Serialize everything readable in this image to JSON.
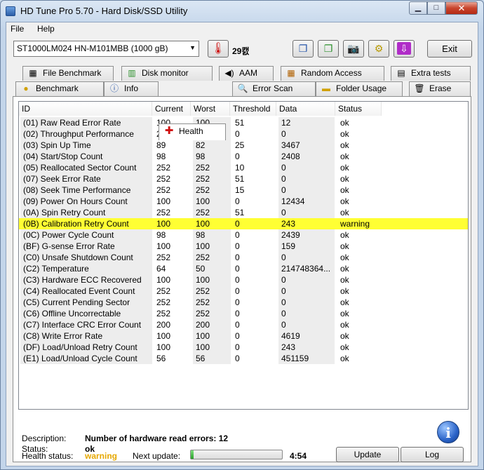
{
  "window": {
    "title": "HD Tune Pro 5.70 - Hard Disk/SSD Utility"
  },
  "menu": {
    "file": "File",
    "help": "Help"
  },
  "toolbar": {
    "drive": "ST1000LM024 HN-M101MBB (1000 gB)",
    "temperature": "29캜",
    "exit_label": "Exit"
  },
  "tabs_top": [
    {
      "label": "File Benchmark",
      "icon": "file-benchmark-icon"
    },
    {
      "label": "Disk monitor",
      "icon": "disk-monitor-icon"
    },
    {
      "label": "AAM",
      "icon": "speaker-icon"
    },
    {
      "label": "Random Access",
      "icon": "random-access-icon"
    },
    {
      "label": "Extra tests",
      "icon": "extra-tests-icon"
    }
  ],
  "tabs_bottom": [
    {
      "label": "Benchmark",
      "icon": "benchmark-icon"
    },
    {
      "label": "Info",
      "icon": "info-icon"
    },
    {
      "label": "Health",
      "icon": "health-cross-icon"
    },
    {
      "label": "Error Scan",
      "icon": "magnifier-icon"
    },
    {
      "label": "Folder Usage",
      "icon": "folder-icon"
    },
    {
      "label": "Erase",
      "icon": "trash-icon"
    }
  ],
  "table": {
    "headers": [
      "ID",
      "Current",
      "Worst",
      "Threshold",
      "Data",
      "Status"
    ],
    "rows": [
      [
        "(01) Raw Read Error Rate",
        "100",
        "100",
        "51",
        "12",
        "ok"
      ],
      [
        "(02) Throughput Performance",
        "252",
        "252",
        "0",
        "0",
        "ok"
      ],
      [
        "(03) Spin Up Time",
        "89",
        "82",
        "25",
        "3467",
        "ok"
      ],
      [
        "(04) Start/Stop Count",
        "98",
        "98",
        "0",
        "2408",
        "ok"
      ],
      [
        "(05) Reallocated Sector Count",
        "252",
        "252",
        "10",
        "0",
        "ok"
      ],
      [
        "(07) Seek Error Rate",
        "252",
        "252",
        "51",
        "0",
        "ok"
      ],
      [
        "(08) Seek Time Performance",
        "252",
        "252",
        "15",
        "0",
        "ok"
      ],
      [
        "(09) Power On Hours Count",
        "100",
        "100",
        "0",
        "12434",
        "ok"
      ],
      [
        "(0A) Spin Retry Count",
        "252",
        "252",
        "51",
        "0",
        "ok"
      ],
      [
        "(0B) Calibration Retry Count",
        "100",
        "100",
        "0",
        "243",
        "warning"
      ],
      [
        "(0C) Power Cycle Count",
        "98",
        "98",
        "0",
        "2439",
        "ok"
      ],
      [
        "(BF) G-sense Error Rate",
        "100",
        "100",
        "0",
        "159",
        "ok"
      ],
      [
        "(C0) Unsafe Shutdown Count",
        "252",
        "252",
        "0",
        "0",
        "ok"
      ],
      [
        "(C2) Temperature",
        "64",
        "50",
        "0",
        "214748364...",
        "ok"
      ],
      [
        "(C3) Hardware ECC Recovered",
        "100",
        "100",
        "0",
        "0",
        "ok"
      ],
      [
        "(C4) Reallocated Event Count",
        "252",
        "252",
        "0",
        "0",
        "ok"
      ],
      [
        "(C5) Current Pending Sector",
        "252",
        "252",
        "0",
        "0",
        "ok"
      ],
      [
        "(C6) Offline Uncorrectable",
        "252",
        "252",
        "0",
        "0",
        "ok"
      ],
      [
        "(C7) Interface CRC Error Count",
        "200",
        "200",
        "0",
        "0",
        "ok"
      ],
      [
        "(C8) Write Error Rate",
        "100",
        "100",
        "0",
        "4619",
        "ok"
      ],
      [
        "(DF) Load/Unload Retry Count",
        "100",
        "100",
        "0",
        "243",
        "ok"
      ],
      [
        "(E1) Load/Unload Cycle Count",
        "56",
        "56",
        "0",
        "451159",
        "ok"
      ]
    ]
  },
  "details": {
    "description_label": "Description:",
    "description_value": "Number of hardware read errors: 12",
    "status_label": "Status:",
    "status_value": "ok"
  },
  "statusbar": {
    "health_label": "Health status:",
    "health_value": "warning",
    "next_update_label": "Next update:",
    "progress_fraction": 0.03,
    "time_left": "4:54",
    "update_label": "Update",
    "log_label": "Log"
  },
  "colors": {
    "warning_row": "#ffff33",
    "warning_text": "#e6a800"
  }
}
